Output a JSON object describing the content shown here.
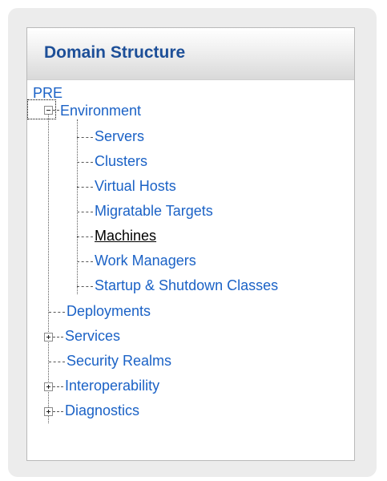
{
  "panel": {
    "title": "Domain Structure"
  },
  "tree": {
    "root": "PRE",
    "environment": {
      "label": "Environment",
      "children": [
        "Servers",
        "Clusters",
        "Virtual Hosts",
        "Migratable Targets",
        "Machines",
        "Work Managers",
        "Startup & Shutdown Classes"
      ],
      "selected": "Machines"
    },
    "items": [
      "Deployments",
      "Services",
      "Security Realms",
      "Interoperability",
      "Diagnostics"
    ]
  },
  "icons": {
    "expanded": "minus-box-icon",
    "collapsed": "plus-box-icon"
  },
  "colors": {
    "link": "#1b62c6",
    "title": "#1d4f98",
    "selected": "#000000"
  }
}
